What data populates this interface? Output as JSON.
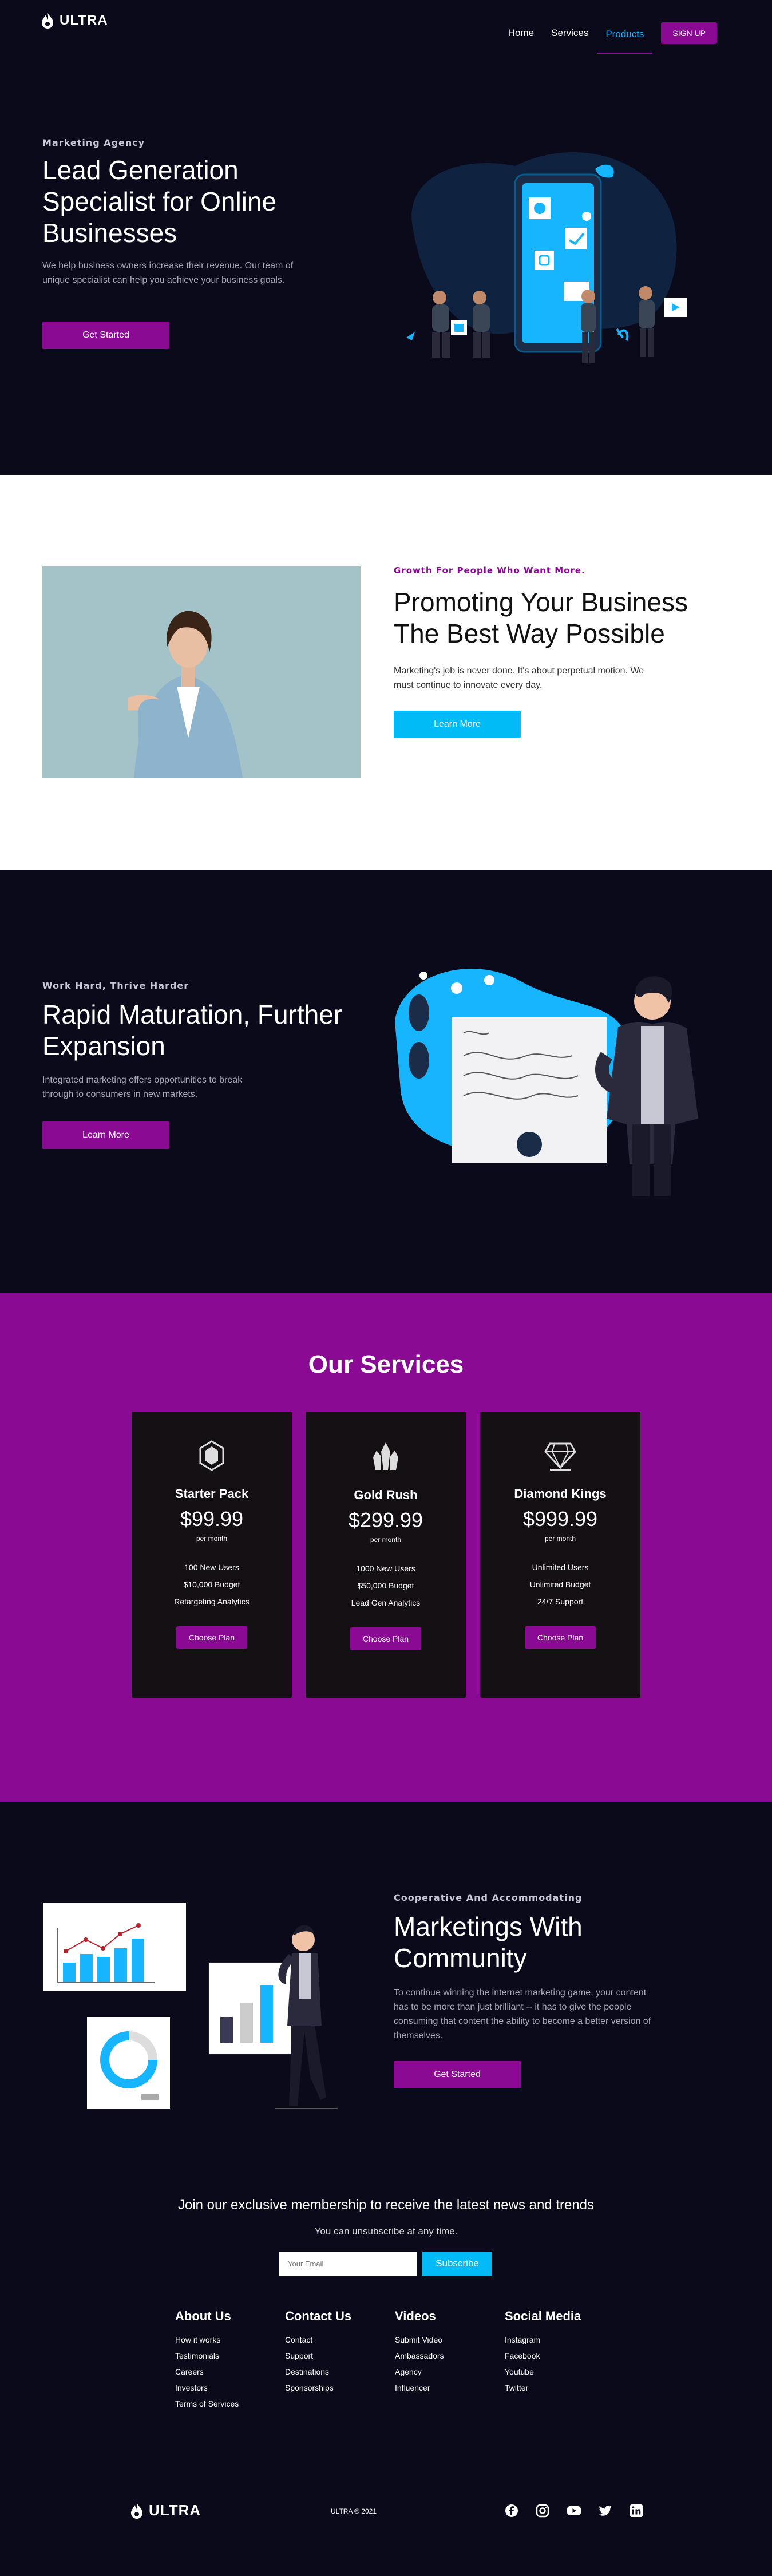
{
  "nav": {
    "brand": "ULTRA",
    "links": [
      "Home",
      "Services",
      "Products"
    ],
    "signup": "SIGN UP"
  },
  "hero": {
    "eyebrow": "Marketing Agency",
    "title": "Lead Generation Specialist for Online Businesses",
    "text": "We help business owners increase their revenue. Our team of unique specialist can help you achieve your business goals.",
    "cta": "Get Started"
  },
  "promote": {
    "eyebrow": "Growth For People Who Want More.",
    "title": "Promoting Your Business The Best Way Possible",
    "text": "Marketing's job is never done. It's about perpetual motion. We must continue to innovate every day.",
    "cta": "Learn More"
  },
  "rapid": {
    "eyebrow": "Work Hard, Thrive Harder",
    "title": "Rapid Maturation, Further Expansion",
    "text": "Integrated marketing offers opportunities to break through to consumers in new markets.",
    "cta": "Learn More"
  },
  "services": {
    "title": "Our Services",
    "cards": [
      {
        "icon": "gem-icon",
        "name": "Starter Pack",
        "price": "$99.99",
        "period": "per month",
        "features": [
          "100 New Users",
          "$10,000 Budget",
          "Retargeting Analytics"
        ],
        "cta": "Choose Plan"
      },
      {
        "icon": "crystals-icon",
        "name": "Gold Rush",
        "price": "$299.99",
        "period": "per month",
        "features": [
          "1000 New Users",
          "$50,000 Budget",
          "Lead Gen Analytics"
        ],
        "cta": "Choose Plan"
      },
      {
        "icon": "diamond-icon",
        "name": "Diamond Kings",
        "price": "$999.99",
        "period": "per month",
        "features": [
          "Unlimited Users",
          "Unlimited Budget",
          "24/7 Support"
        ],
        "cta": "Choose Plan"
      }
    ]
  },
  "marketing": {
    "eyebrow": "Cooperative And Accommodating",
    "title": "Marketings With Community",
    "text": "To continue winning the internet marketing game, your content has to be more than just brilliant -- it has to give the people consuming that content the ability to become a better version of themselves.",
    "cta": "Get Started"
  },
  "newsletter": {
    "heading": "Join our exclusive membership to receive the latest news and trends",
    "sub": "You can unsubscribe at any time.",
    "placeholder": "Your Email",
    "button": "Subscribe"
  },
  "footer": {
    "columns": [
      {
        "title": "About Us",
        "links": [
          "How it works",
          "Testimonials",
          "Careers",
          "Investors",
          "Terms of Services"
        ]
      },
      {
        "title": "Contact Us",
        "links": [
          "Contact",
          "Support",
          "Destinations",
          "Sponsorships"
        ]
      },
      {
        "title": "Videos",
        "links": [
          "Submit Video",
          "Ambassadors",
          "Agency",
          "Influencer"
        ]
      },
      {
        "title": "Social Media",
        "links": [
          "Instagram",
          "Facebook",
          "Youtube",
          "Twitter"
        ]
      }
    ],
    "brand": "ULTRA",
    "copyright": "ULTRA © 2021",
    "social_icons": [
      "facebook-icon",
      "instagram-icon",
      "youtube-icon",
      "twitter-icon",
      "linkedin-icon"
    ]
  },
  "colors": {
    "dark_bg": "#0b0a1a",
    "purple": "#8a0a93",
    "cyan": "#00bbf5",
    "card_bg": "#141014"
  }
}
